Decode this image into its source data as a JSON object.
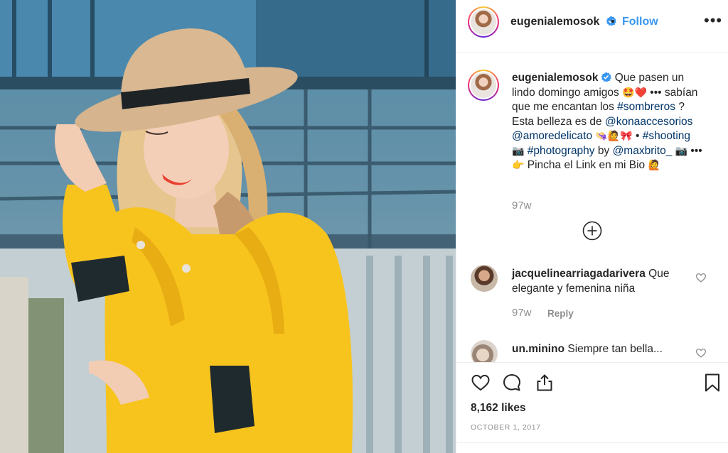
{
  "post": {
    "image_alt": "Woman in yellow coat and tan wide-brim hat"
  },
  "header": {
    "username": "eugenialemosok",
    "separator": "•",
    "follow_label": "Follow",
    "more_label": "•••"
  },
  "caption": {
    "username": "eugenialemosok",
    "text_1": "Que pasen un lindo domingo amigos",
    "emoji_1": "🤩❤️",
    "dots_1": "•••",
    "text_2": "sabían que me encantan los",
    "hashtag_sombreros": "#sombreros",
    "text_3": "? Esta belleza es de",
    "mention_kona": "@konaaccesorios",
    "mention_amore": "@amoredelicato",
    "emoji_2": "👒🙋🎀",
    "bullet": "•",
    "hashtag_shooting": "#shooting",
    "emoji_camera_1": "📷",
    "hashtag_photography": "#photography",
    "text_by": "by",
    "mention_maxbrito": "@maxbrito_",
    "emoji_camera_2": "📷",
    "dots_2": "•••",
    "emoji_point": "👉",
    "text_4": "Pincha el Link en mi Bio",
    "emoji_3": "🙋",
    "time": "97w"
  },
  "comments": [
    {
      "username": "jacquelinearriagadarivera",
      "text": "Que elegante y femenina niña",
      "time": "97w",
      "reply_label": "Reply"
    },
    {
      "username": "un.minino",
      "text": "Siempre tan bella..."
    }
  ],
  "actions": {
    "likes": "8,162 likes",
    "date": "OCTOBER 1, 2017"
  },
  "colors": {
    "link": "#003569",
    "follow": "#3897f0",
    "muted": "#8e8e8e",
    "coat": "#f7c41e"
  }
}
